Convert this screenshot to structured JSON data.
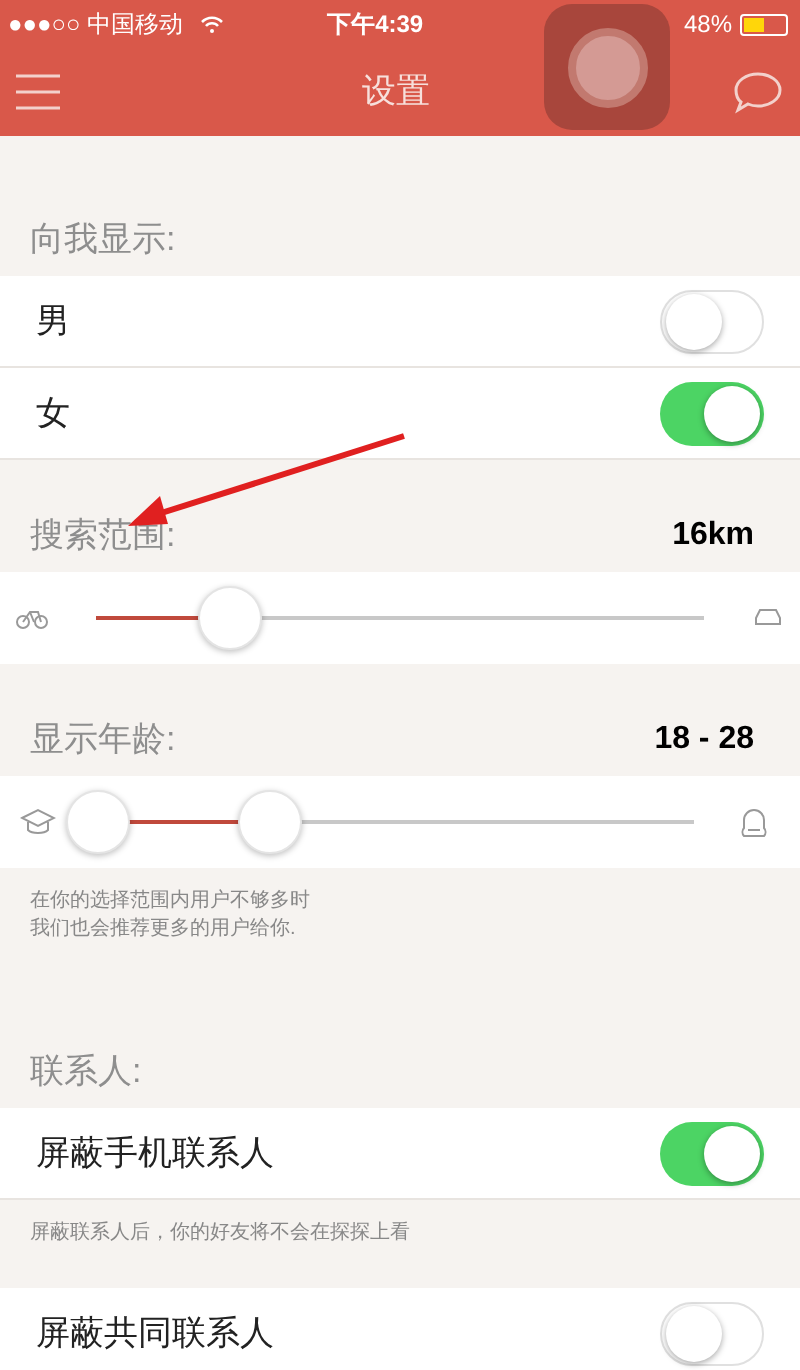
{
  "status_bar": {
    "carrier": "●●●○○ 中国移动",
    "time": "下午4:39",
    "battery": "48%"
  },
  "nav": {
    "title": "设置"
  },
  "sections": [
    {
      "kind": "toggles",
      "header": "向我显示:",
      "rows": [
        {
          "label": "男",
          "on": false
        },
        {
          "label": "女",
          "on": true
        }
      ]
    },
    {
      "kind": "slider",
      "header": "搜索范围:",
      "value": "16km",
      "level": 0.22
    },
    {
      "kind": "range",
      "header": "显示年龄:",
      "value": "18 - 28",
      "level": 0.29,
      "notes": [
        "在你的选择范围内用户不够多时",
        "我们也会推荐更多的用户给你."
      ]
    },
    {
      "kind": "toggles",
      "header": "联系人:",
      "rows": [
        {
          "label": "屏蔽手机联系人",
          "on": true
        }
      ],
      "notes": [
        "屏蔽联系人后，你的好友将不会在探探上看"
      ]
    },
    {
      "kind": "toggles",
      "rows": [
        {
          "label": "屏蔽共同联系人",
          "on": false
        }
      ]
    }
  ]
}
